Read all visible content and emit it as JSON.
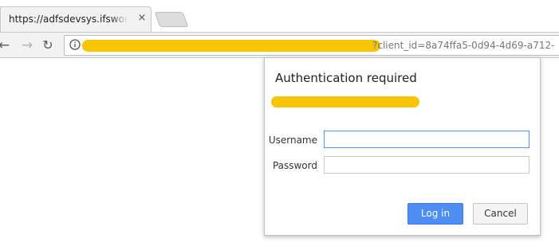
{
  "browser": {
    "tab_title": "https://adfsdevsys.ifsworld.com",
    "tab_close_glyph": "×",
    "url_visible_tail": "?client_id=8a74ffa5-0d94-4d69-a712-",
    "colors": {
      "redaction": "#f7c600",
      "primary_button": "#4d8ef5"
    }
  },
  "nav": {
    "back_glyph": "←",
    "forward_glyph": "→",
    "reload_glyph": "↻"
  },
  "dialog": {
    "title": "Authentication required",
    "username_label": "Username",
    "password_label": "Password",
    "username_value": "",
    "password_value": "",
    "login_label": "Log in",
    "cancel_label": "Cancel"
  }
}
